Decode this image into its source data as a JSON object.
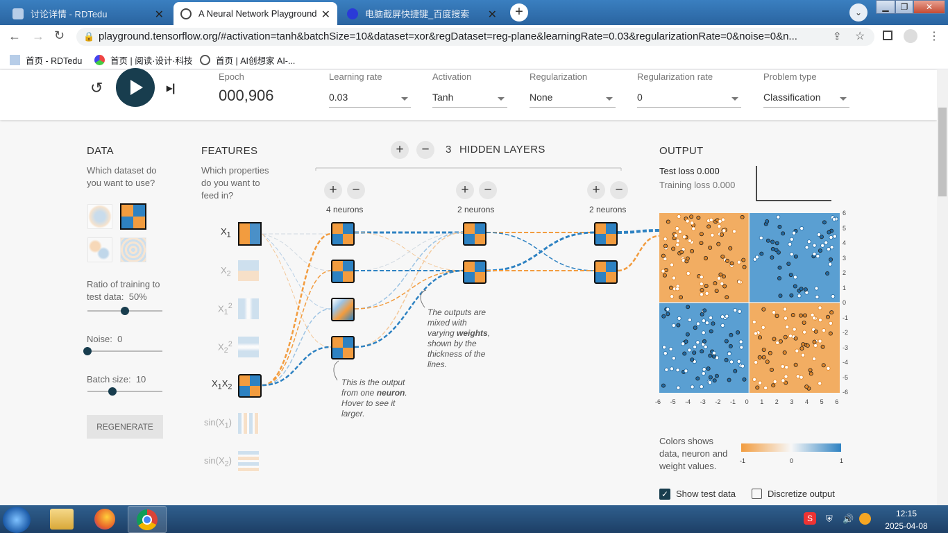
{
  "browser": {
    "tabs": [
      {
        "title": "讨论详情 - RDTedu",
        "active": false
      },
      {
        "title": "A Neural Network Playground",
        "active": true
      },
      {
        "title": "电脑截屏快捷键_百度搜索",
        "active": false
      }
    ],
    "url": "playground.tensorflow.org/#activation=tanh&batchSize=10&dataset=xor&regDataset=reg-plane&learningRate=0.03&regularizationRate=0&noise=0&n...",
    "bookmarks": [
      "首页 - RDTedu",
      "首页 | 阅读·设计·科技",
      "首页 | AI创想家 AI-..."
    ]
  },
  "header": {
    "epoch_label": "Epoch",
    "epoch_value": "000,906",
    "learning_rate_label": "Learning rate",
    "learning_rate": "0.03",
    "activation_label": "Activation",
    "activation": "Tanh",
    "regularization_label": "Regularization",
    "regularization": "None",
    "reg_rate_label": "Regularization rate",
    "reg_rate": "0",
    "problem_label": "Problem type",
    "problem": "Classification"
  },
  "data_panel": {
    "title": "DATA",
    "question": "Which dataset do you want to use?",
    "ratio_label": "Ratio of training to test data:",
    "ratio_value": "50%",
    "ratio_fraction": 0.5,
    "noise_label": "Noise:",
    "noise_value": "0",
    "noise_fraction": 0,
    "batch_label": "Batch size:",
    "batch_value": "10",
    "batch_fraction": 0.33,
    "regenerate": "REGENERATE"
  },
  "features": {
    "title": "FEATURES",
    "question": "Which properties do you want to feed in?",
    "items": [
      "X1",
      "X2",
      "X1²",
      "X2²",
      "X1X2",
      "sin(X1)",
      "sin(X2)"
    ]
  },
  "hidden": {
    "count": "3",
    "label": "HIDDEN LAYERS",
    "layers": [
      "4 neurons",
      "2 neurons",
      "2 neurons"
    ],
    "note1_a": "The outputs are mixed with varying ",
    "note1_b": "weights",
    ", shown by the thickness of the lines.": "",
    "note1_c": ", shown by the thickness of the lines.",
    "note2_a": "This is the output from one ",
    "note2_b": "neuron",
    "note2_c": ". Hover to see it larger."
  },
  "output": {
    "title": "OUTPUT",
    "test_loss": "Test loss 0.000",
    "training_loss": "Training loss 0.000",
    "y_ticks": [
      "6",
      "5",
      "4",
      "3",
      "2",
      "1",
      "0",
      "-1",
      "-2",
      "-3",
      "-4",
      "-5",
      "-6"
    ],
    "x_ticks": [
      "-6",
      "-5",
      "-4",
      "-3",
      "-2",
      "-1",
      "0",
      "1",
      "2",
      "3",
      "4",
      "5",
      "6"
    ],
    "legend_text": "Colors shows data, neuron and weight values.",
    "legend_ticks": [
      "-1",
      "0",
      "1"
    ],
    "show_test": "Show test data",
    "discretize": "Discretize output",
    "colors": {
      "orange": "#f29c3f",
      "blue": "#2e82c2"
    }
  },
  "taskbar": {
    "time": "12:15",
    "date": "2025-04-08"
  }
}
